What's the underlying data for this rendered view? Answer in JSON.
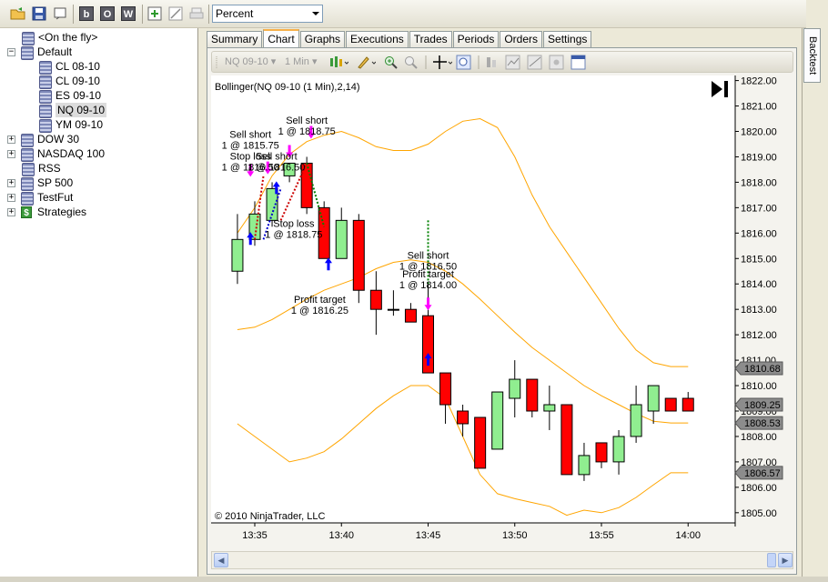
{
  "toolbar": {
    "zoom_value": "Percent",
    "letter_buttons": [
      "b",
      "O",
      "W"
    ]
  },
  "tree": {
    "items": [
      {
        "label": "<On the fly>",
        "level": 1,
        "expander": "",
        "icon": "database-icon"
      },
      {
        "label": "Default",
        "level": 0,
        "expander": "−",
        "icon": "database-icon"
      },
      {
        "label": "CL 08-10",
        "level": 2,
        "expander": "",
        "icon": "database-icon"
      },
      {
        "label": "CL 09-10",
        "level": 2,
        "expander": "",
        "icon": "database-icon"
      },
      {
        "label": "ES 09-10",
        "level": 2,
        "expander": "",
        "icon": "database-icon"
      },
      {
        "label": "NQ 09-10",
        "level": 2,
        "expander": "",
        "icon": "database-icon",
        "selected": true
      },
      {
        "label": "YM 09-10",
        "level": 2,
        "expander": "",
        "icon": "database-icon"
      },
      {
        "label": "DOW 30",
        "level": 0,
        "expander": "+",
        "icon": "database-icon"
      },
      {
        "label": "NASDAQ 100",
        "level": 0,
        "expander": "+",
        "icon": "database-icon"
      },
      {
        "label": "RSS",
        "level": 1,
        "expander": "",
        "icon": "database-icon"
      },
      {
        "label": "SP 500",
        "level": 0,
        "expander": "+",
        "icon": "database-icon"
      },
      {
        "label": "TestFut",
        "level": 0,
        "expander": "+",
        "icon": "database-icon"
      },
      {
        "label": "Strategies",
        "level": 0,
        "expander": "+",
        "icon": "dollar-icon"
      }
    ]
  },
  "tabs": [
    "Summary",
    "Chart",
    "Graphs",
    "Executions",
    "Trades",
    "Periods",
    "Orders",
    "Settings"
  ],
  "active_tab": "Chart",
  "chart_toolbar": {
    "instrument": "NQ 09-10",
    "interval": "1 Min"
  },
  "right_panel": {
    "tab_label": "Backtest"
  },
  "colors": {
    "up_candle": "#90ee90",
    "down_candle": "#ff0000",
    "band": "#ffa500",
    "accent": "#f7b04a"
  },
  "chart_data": {
    "type": "candlestick",
    "title": "Bollinger(NQ 09-10 (1 Min),2,14)",
    "copyright": "© 2010 NinjaTrader, LLC",
    "ylim": [
      1804.6,
      1822.2
    ],
    "yticks": [
      "1805.00",
      "1806.00",
      "1807.00",
      "1808.00",
      "1809.00",
      "1810.00",
      "1811.00",
      "1812.00",
      "1813.00",
      "1814.00",
      "1815.00",
      "1816.00",
      "1817.00",
      "1818.00",
      "1819.00",
      "1820.00",
      "1821.00",
      "1822.00"
    ],
    "x_tick_labels": [
      {
        "label": "13:35",
        "minute": 0
      },
      {
        "label": "13:40",
        "minute": 5
      },
      {
        "label": "13:45",
        "minute": 10
      },
      {
        "label": "13:50",
        "minute": 15
      },
      {
        "label": "13:55",
        "minute": 20
      },
      {
        "label": "14:00",
        "minute": 25
      }
    ],
    "candles": [
      {
        "m": -1,
        "o": 1814.5,
        "h": 1816.75,
        "l": 1814.0,
        "c": 1815.75
      },
      {
        "m": 0,
        "o": 1815.75,
        "h": 1817.25,
        "l": 1815.5,
        "c": 1816.75
      },
      {
        "m": 1,
        "o": 1816.5,
        "h": 1818.0,
        "l": 1816.25,
        "c": 1817.75
      },
      {
        "m": 2,
        "o": 1818.25,
        "h": 1818.75,
        "l": 1818.0,
        "c": 1818.75
      },
      {
        "m": 3,
        "o": 1818.75,
        "h": 1819.0,
        "l": 1816.75,
        "c": 1817.0
      },
      {
        "m": 4,
        "o": 1817.0,
        "h": 1817.25,
        "l": 1815.0,
        "c": 1815.0
      },
      {
        "m": 5,
        "o": 1815.0,
        "h": 1817.0,
        "l": 1815.0,
        "c": 1816.5
      },
      {
        "m": 6,
        "o": 1816.5,
        "h": 1816.75,
        "l": 1813.25,
        "c": 1813.75
      },
      {
        "m": 7,
        "o": 1813.75,
        "h": 1814.5,
        "l": 1812.0,
        "c": 1813.0
      },
      {
        "m": 8,
        "o": 1813.0,
        "h": 1813.75,
        "l": 1812.75,
        "c": 1813.0
      },
      {
        "m": 9,
        "o": 1813.0,
        "h": 1813.25,
        "l": 1812.5,
        "c": 1812.5
      },
      {
        "m": 10,
        "o": 1812.75,
        "h": 1814.0,
        "l": 1810.5,
        "c": 1810.5
      },
      {
        "m": 11,
        "o": 1810.5,
        "h": 1810.5,
        "l": 1808.5,
        "c": 1809.25
      },
      {
        "m": 12,
        "o": 1809.0,
        "h": 1809.25,
        "l": 1808.0,
        "c": 1808.5
      },
      {
        "m": 13,
        "o": 1808.75,
        "h": 1808.75,
        "l": 1806.75,
        "c": 1806.75
      },
      {
        "m": 14,
        "o": 1807.5,
        "h": 1809.75,
        "l": 1807.5,
        "c": 1809.75
      },
      {
        "m": 15,
        "o": 1809.5,
        "h": 1811.0,
        "l": 1808.75,
        "c": 1810.25
      },
      {
        "m": 16,
        "o": 1810.25,
        "h": 1810.25,
        "l": 1808.75,
        "c": 1809.0
      },
      {
        "m": 17,
        "o": 1809.0,
        "h": 1810.0,
        "l": 1808.25,
        "c": 1809.25
      },
      {
        "m": 18,
        "o": 1809.25,
        "h": 1809.25,
        "l": 1806.5,
        "c": 1806.5
      },
      {
        "m": 19,
        "o": 1806.5,
        "h": 1807.75,
        "l": 1806.25,
        "c": 1807.25
      },
      {
        "m": 20,
        "o": 1807.75,
        "h": 1807.75,
        "l": 1806.75,
        "c": 1807.0
      },
      {
        "m": 21,
        "o": 1807.0,
        "h": 1808.25,
        "l": 1806.5,
        "c": 1808.0
      },
      {
        "m": 22,
        "o": 1808.0,
        "h": 1810.0,
        "l": 1807.75,
        "c": 1809.25
      },
      {
        "m": 23,
        "o": 1809.0,
        "h": 1810.0,
        "l": 1808.5,
        "c": 1810.0
      },
      {
        "m": 24,
        "o": 1809.5,
        "h": 1809.5,
        "l": 1809.0,
        "c": 1809.0
      },
      {
        "m": 25,
        "o": 1809.5,
        "h": 1809.75,
        "l": 1809.0,
        "c": 1809.0
      }
    ],
    "upper_band": [
      {
        "m": -1,
        "v": 1816.0
      },
      {
        "m": 0,
        "v": 1817.0
      },
      {
        "m": 1,
        "v": 1818.25
      },
      {
        "m": 2,
        "v": 1819.1
      },
      {
        "m": 3,
        "v": 1819.6
      },
      {
        "m": 4,
        "v": 1819.85
      },
      {
        "m": 5,
        "v": 1820.0
      },
      {
        "m": 6,
        "v": 1819.75
      },
      {
        "m": 7,
        "v": 1819.4
      },
      {
        "m": 8,
        "v": 1819.25
      },
      {
        "m": 9,
        "v": 1819.25
      },
      {
        "m": 10,
        "v": 1819.5
      },
      {
        "m": 11,
        "v": 1820.0
      },
      {
        "m": 12,
        "v": 1820.4
      },
      {
        "m": 13,
        "v": 1820.5
      },
      {
        "m": 14,
        "v": 1820.15
      },
      {
        "m": 15,
        "v": 1819.0
      },
      {
        "m": 16,
        "v": 1817.5
      },
      {
        "m": 17,
        "v": 1816.25
      },
      {
        "m": 18,
        "v": 1815.25
      },
      {
        "m": 19,
        "v": 1814.25
      },
      {
        "m": 20,
        "v": 1813.25
      },
      {
        "m": 21,
        "v": 1812.25
      },
      {
        "m": 22,
        "v": 1811.4
      },
      {
        "m": 23,
        "v": 1810.9
      },
      {
        "m": 24,
        "v": 1810.75
      },
      {
        "m": 25,
        "v": 1810.75
      }
    ],
    "middle_band": [
      {
        "m": -1,
        "v": 1812.2
      },
      {
        "m": 0,
        "v": 1812.3
      },
      {
        "m": 1,
        "v": 1812.6
      },
      {
        "m": 2,
        "v": 1813.0
      },
      {
        "m": 3,
        "v": 1813.4
      },
      {
        "m": 4,
        "v": 1813.75
      },
      {
        "m": 5,
        "v": 1814.0
      },
      {
        "m": 6,
        "v": 1814.25
      },
      {
        "m": 7,
        "v": 1814.6
      },
      {
        "m": 8,
        "v": 1814.85
      },
      {
        "m": 9,
        "v": 1814.95
      },
      {
        "m": 10,
        "v": 1814.85
      },
      {
        "m": 11,
        "v": 1814.5
      },
      {
        "m": 12,
        "v": 1814.0
      },
      {
        "m": 13,
        "v": 1813.4
      },
      {
        "m": 14,
        "v": 1812.75
      },
      {
        "m": 15,
        "v": 1812.1
      },
      {
        "m": 16,
        "v": 1811.5
      },
      {
        "m": 17,
        "v": 1811.0
      },
      {
        "m": 18,
        "v": 1810.5
      },
      {
        "m": 19,
        "v": 1810.0
      },
      {
        "m": 20,
        "v": 1809.6
      },
      {
        "m": 21,
        "v": 1809.25
      },
      {
        "m": 22,
        "v": 1808.9
      },
      {
        "m": 23,
        "v": 1808.6
      },
      {
        "m": 24,
        "v": 1808.53
      },
      {
        "m": 25,
        "v": 1808.53
      }
    ],
    "lower_band": [
      {
        "m": -1,
        "v": 1808.5
      },
      {
        "m": 0,
        "v": 1808.0
      },
      {
        "m": 1,
        "v": 1807.5
      },
      {
        "m": 2,
        "v": 1807.0
      },
      {
        "m": 3,
        "v": 1807.15
      },
      {
        "m": 4,
        "v": 1807.4
      },
      {
        "m": 5,
        "v": 1807.9
      },
      {
        "m": 6,
        "v": 1808.5
      },
      {
        "m": 7,
        "v": 1809.1
      },
      {
        "m": 8,
        "v": 1809.6
      },
      {
        "m": 9,
        "v": 1810.0
      },
      {
        "m": 10,
        "v": 1810.0
      },
      {
        "m": 11,
        "v": 1809.5
      },
      {
        "m": 12,
        "v": 1808.0
      },
      {
        "m": 13,
        "v": 1806.5
      },
      {
        "m": 14,
        "v": 1805.75
      },
      {
        "m": 15,
        "v": 1805.55
      },
      {
        "m": 16,
        "v": 1805.4
      },
      {
        "m": 17,
        "v": 1805.25
      },
      {
        "m": 18,
        "v": 1804.9
      },
      {
        "m": 19,
        "v": 1805.1
      },
      {
        "m": 20,
        "v": 1805.0
      },
      {
        "m": 21,
        "v": 1805.2
      },
      {
        "m": 22,
        "v": 1805.6
      },
      {
        "m": 23,
        "v": 1806.1
      },
      {
        "m": 24,
        "v": 1806.57
      },
      {
        "m": 25,
        "v": 1806.57
      }
    ],
    "price_tags": [
      {
        "label": "1810.68",
        "v": 1810.68
      },
      {
        "label": "1809.25",
        "v": 1809.25
      },
      {
        "label": "1808.53",
        "v": 1808.53
      },
      {
        "label": "1806.57",
        "v": 1806.57
      }
    ],
    "trade_lines": [
      {
        "m1": 0,
        "v1": 1815.75,
        "m2": 0.5,
        "v2": 1818.25,
        "color": "#cc0000"
      },
      {
        "m1": 0.5,
        "v1": 1815.75,
        "m2": 1.5,
        "v2": 1817.75,
        "color": "#0000cc"
      },
      {
        "m1": 1.5,
        "v1": 1816.5,
        "m2": 3,
        "v2": 1818.75,
        "color": "#cc0000"
      },
      {
        "m1": 3,
        "v1": 1818.75,
        "m2": 4,
        "v2": 1816.25,
        "color": "#008000"
      },
      {
        "m1": 10,
        "v1": 1816.5,
        "m2": 10,
        "v2": 1814.0,
        "color": "#008000"
      }
    ],
    "markers": [
      {
        "m": -0.25,
        "v": 1815.75,
        "dir": "up"
      },
      {
        "m": 1.25,
        "v": 1817.75,
        "dir": "up"
      },
      {
        "m": 4.25,
        "v": 1814.75,
        "dir": "up"
      },
      {
        "m": 10,
        "v": 1811.0,
        "dir": "up"
      },
      {
        "m": -0.25,
        "v": 1818.5,
        "dir": "down"
      },
      {
        "m": 0.75,
        "v": 1818.6,
        "dir": "down"
      },
      {
        "m": 2.0,
        "v": 1819.25,
        "dir": "down"
      },
      {
        "m": 3.25,
        "v": 1820.0,
        "dir": "down"
      },
      {
        "m": 10,
        "v": 1813.25,
        "dir": "down"
      }
    ],
    "annotations": [
      {
        "lines": [
          "Sell short",
          "1 @ 1815.75"
        ],
        "m": -0.25,
        "v": 1819.75
      },
      {
        "lines": [
          "Stop loss",
          "1 @ 1816.50"
        ],
        "m": -0.25,
        "v": 1818.9
      },
      {
        "lines": [
          "Sell short",
          "1 @ 1816.50"
        ],
        "m": 1.25,
        "v": 1818.9
      },
      {
        "lines": [
          "Sell short",
          "1 @ 1818.75"
        ],
        "m": 3.0,
        "v": 1820.3
      },
      {
        "lines": [
          "Stop loss",
          "1 @ 1818.75"
        ],
        "m": 2.25,
        "v": 1816.25
      },
      {
        "lines": [
          "Profit target",
          "1 @ 1816.25"
        ],
        "m": 3.75,
        "v": 1813.25
      },
      {
        "lines": [
          "Sell short",
          "1 @ 1816.50"
        ],
        "m": 10,
        "v": 1815.0
      },
      {
        "lines": [
          "Profit target",
          "1 @ 1814.00"
        ],
        "m": 10,
        "v": 1814.25
      }
    ]
  }
}
